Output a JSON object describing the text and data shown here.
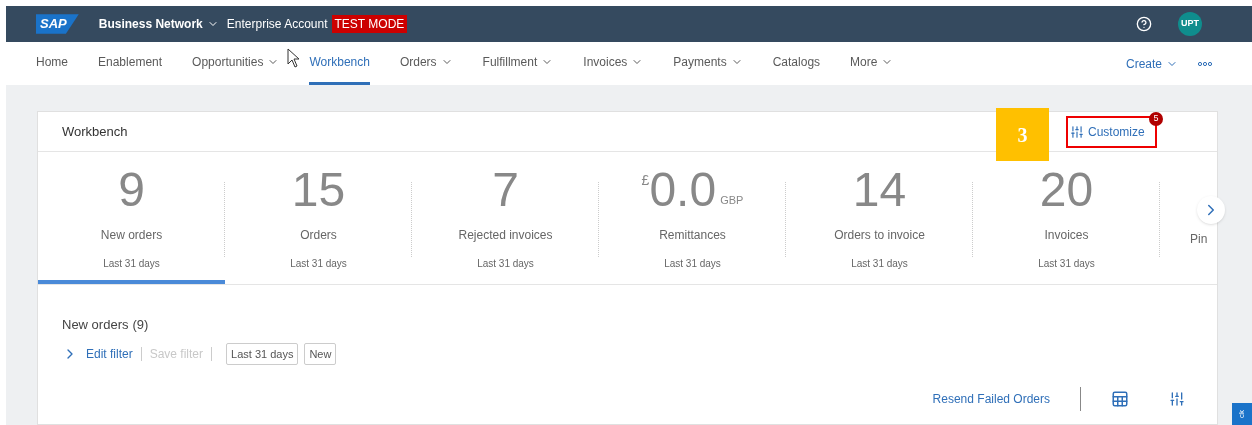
{
  "header": {
    "logo": "SAP",
    "product": "Business Network",
    "account": "Enterprise Account",
    "mode_badge": "TEST MODE",
    "avatar": "UPT"
  },
  "nav": {
    "items": [
      {
        "label": "Home",
        "dropdown": false,
        "selected": false
      },
      {
        "label": "Enablement",
        "dropdown": false,
        "selected": false
      },
      {
        "label": "Opportunities",
        "dropdown": true,
        "selected": false
      },
      {
        "label": "Workbench",
        "dropdown": false,
        "selected": true
      },
      {
        "label": "Orders",
        "dropdown": true,
        "selected": false
      },
      {
        "label": "Fulfillment",
        "dropdown": true,
        "selected": false
      },
      {
        "label": "Invoices",
        "dropdown": true,
        "selected": false
      },
      {
        "label": "Payments",
        "dropdown": true,
        "selected": false
      },
      {
        "label": "Catalogs",
        "dropdown": false,
        "selected": false
      },
      {
        "label": "More",
        "dropdown": true,
        "selected": false
      }
    ],
    "create": "Create"
  },
  "workbench": {
    "title": "Workbench",
    "step_marker": "3",
    "customize": "Customize",
    "customize_badge": "5",
    "tiles": [
      {
        "value": "9",
        "label": "New orders",
        "period": "Last 31 days",
        "selected": true
      },
      {
        "value": "15",
        "label": "Orders",
        "period": "Last 31 days",
        "selected": false
      },
      {
        "value": "7",
        "label": "Rejected invoices",
        "period": "Last 31 days",
        "selected": false
      },
      {
        "prefix": "£",
        "value": "0.0",
        "suffix": "GBP",
        "label": "Remittances",
        "period": "Last 31 days",
        "selected": false
      },
      {
        "value": "14",
        "label": "Orders to invoice",
        "period": "Last 31 days",
        "selected": false
      },
      {
        "value": "20",
        "label": "Invoices",
        "period": "Last 31 days",
        "selected": false
      },
      {
        "label": "Pin",
        "selected": false
      }
    ]
  },
  "section": {
    "title": "New orders",
    "count": "(9)",
    "edit_filter": "Edit filter",
    "save_filter": "Save filter",
    "filter_chips": [
      "Last 31 days",
      "New"
    ],
    "resend": "Resend Failed Orders"
  },
  "feedback_tab": "ck"
}
